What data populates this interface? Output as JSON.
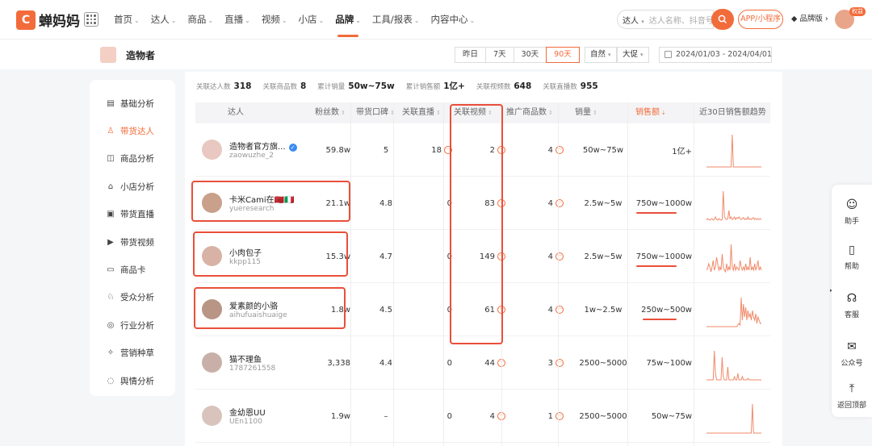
{
  "app": {
    "logo_text": "蝉妈妈"
  },
  "nav": [
    {
      "label": "首页",
      "caret": true
    },
    {
      "label": "达人",
      "caret": true
    },
    {
      "label": "商品",
      "caret": true
    },
    {
      "label": "直播",
      "caret": true
    },
    {
      "label": "视频",
      "caret": true
    },
    {
      "label": "小店",
      "caret": true
    },
    {
      "label": "品牌",
      "caret": true,
      "active": true
    },
    {
      "label": "工具/报表",
      "caret": true
    },
    {
      "label": "内容中心",
      "caret": true
    }
  ],
  "search": {
    "scope": "达人",
    "placeholder": "达人名称、抖音号"
  },
  "header": {
    "app_button": "APP/小程序",
    "brand_version": "品牌版",
    "vip_badge": "权益"
  },
  "brand": {
    "name": "造物者"
  },
  "time_ranges": [
    "昨日",
    "7天",
    "30天",
    "90天"
  ],
  "time_active": "90天",
  "dropdowns": [
    "自然",
    "大促"
  ],
  "date_range": "2024/01/03 - 2024/04/01",
  "sidebar": [
    {
      "label": "基础分析",
      "icon": "chart-icon"
    },
    {
      "label": "带货达人",
      "icon": "person-icon",
      "active": true
    },
    {
      "label": "商品分析",
      "icon": "bag-icon"
    },
    {
      "label": "小店分析",
      "icon": "store-icon"
    },
    {
      "label": "带货直播",
      "icon": "live-icon"
    },
    {
      "label": "带货视频",
      "icon": "play-icon"
    },
    {
      "label": "商品卡",
      "icon": "card-icon"
    },
    {
      "label": "受众分析",
      "icon": "audience-icon"
    },
    {
      "label": "行业分析",
      "icon": "industry-icon"
    },
    {
      "label": "营销种草",
      "icon": "marketing-icon"
    },
    {
      "label": "舆情分析",
      "icon": "sentiment-icon"
    }
  ],
  "stats": [
    {
      "label": "关联达人数",
      "value": "318"
    },
    {
      "label": "关联商品数",
      "value": "8"
    },
    {
      "label": "累计销量",
      "value": "50w~75w"
    },
    {
      "label": "累计销售额",
      "value": "1亿+"
    },
    {
      "label": "关联视频数",
      "value": "648"
    },
    {
      "label": "关联直播数",
      "value": "955"
    }
  ],
  "table": {
    "headers": [
      "达人",
      "粉丝数",
      "带货口碑",
      "关联直播",
      "关联视频",
      "推广商品数",
      "销量",
      "销售额",
      "近30日销售额趋势"
    ],
    "rows": [
      {
        "name": "造物者官方旗...",
        "id": "zaowuzhe_2",
        "verified": true,
        "fans": "59.8w",
        "rating": "5",
        "live": "18",
        "video": "2",
        "products": "4",
        "sales": "50w~75w",
        "revenue": "1亿+",
        "avatar_color": "#e8c8c0",
        "trend": [
          0,
          0,
          0,
          0,
          0,
          0,
          0,
          0,
          0,
          0,
          0,
          0,
          0,
          0,
          0,
          0,
          0,
          0,
          0,
          0,
          0,
          0,
          0,
          1,
          0,
          0,
          0,
          0,
          0,
          0,
          0,
          0,
          0,
          0,
          0,
          0,
          0,
          0,
          0,
          0,
          0,
          0,
          0,
          0,
          0,
          0,
          0,
          0,
          0,
          0
        ]
      },
      {
        "name": "卡米Cami在🇲🇦🇮🇹",
        "id": "yueresearch",
        "verified": false,
        "fans": "21.1w",
        "rating": "4.8",
        "live": "0",
        "video": "83",
        "products": "4",
        "sales": "2.5w~5w",
        "revenue": "750w~1000w",
        "avatar_color": "#c9a08a",
        "trend": [
          0,
          0.05,
          0.02,
          0,
          0.03,
          0.05,
          0,
          0.02,
          0.1,
          0.02,
          0,
          0.05,
          0.02,
          0,
          0.02,
          0.9,
          0.1,
          0.05,
          0.02,
          0.05,
          0.3,
          0.05,
          0.1,
          0.02,
          0.05,
          0.1,
          0.02,
          0.08,
          0.05,
          0.1,
          0.05,
          0.02,
          0.05,
          0.08,
          0.02,
          0.05,
          0.02,
          0.1,
          0.02,
          0.05,
          0.02,
          0.05,
          0.08,
          0.02,
          0.05,
          0.02,
          0.05,
          0.02,
          0.05,
          0.02
        ]
      },
      {
        "name": "小肉包子",
        "id": "kkpp115",
        "verified": false,
        "fans": "15.3w",
        "rating": "4.7",
        "live": "0",
        "video": "149",
        "products": "4",
        "sales": "2.5w~5w",
        "revenue": "750w~1000w",
        "avatar_color": "#d9b2a6",
        "trend": [
          0.1,
          0.15,
          0.3,
          0.2,
          0.05,
          0.2,
          0.4,
          0.1,
          0.2,
          0.5,
          0.3,
          0.1,
          0.2,
          0.1,
          0.6,
          0.2,
          0.1,
          0.05,
          0.3,
          0.1,
          0.2,
          0.1,
          0.9,
          0.2,
          0.1,
          0.3,
          0.1,
          0.2,
          0.15,
          0.1,
          0.4,
          0.2,
          0.1,
          0.2,
          0.1,
          0.3,
          0.1,
          0.2,
          0.1,
          0.5,
          0.1,
          0.2,
          0.1,
          0.3,
          0.1,
          0.2,
          0.4,
          0.1,
          0.2,
          0.1
        ]
      },
      {
        "name": "爱素颜的小骆",
        "id": "aihufuaishuaige",
        "verified": false,
        "fans": "1.8w",
        "rating": "4.5",
        "live": "0",
        "video": "61",
        "products": "4",
        "sales": "1w~2.5w",
        "revenue": "250w~500w",
        "avatar_color": "#b89585",
        "trend": [
          0,
          0,
          0,
          0,
          0,
          0,
          0,
          0,
          0,
          0,
          0,
          0,
          0,
          0,
          0,
          0,
          0,
          0,
          0,
          0,
          0,
          0,
          0,
          0,
          0,
          0,
          0,
          0,
          0.05,
          0.1,
          0.05,
          0.9,
          0.2,
          0.7,
          0.3,
          0.6,
          0.2,
          0.5,
          0.3,
          0.4,
          0.2,
          0.5,
          0.3,
          0.2,
          0.4,
          0.1,
          0.3,
          0.2,
          0.1,
          0.1
        ]
      },
      {
        "name": "猫不理鱼",
        "id": "1787261558",
        "verified": false,
        "fans": "3,338",
        "rating": "4.4",
        "live": "0",
        "video": "44",
        "products": "3",
        "sales": "2500~5000",
        "revenue": "75w~100w",
        "avatar_color": "#c8b0a8",
        "trend": [
          0,
          0,
          0,
          0,
          0,
          0,
          0,
          0.9,
          0.2,
          0,
          0,
          0,
          0,
          0,
          0.7,
          0.1,
          0,
          0,
          0,
          0.4,
          0,
          0,
          0,
          0,
          0,
          0.1,
          0,
          0,
          0.2,
          0,
          0,
          0,
          0.1,
          0,
          0,
          0,
          0,
          0.05,
          0,
          0,
          0,
          0,
          0,
          0,
          0,
          0,
          0,
          0,
          0,
          0
        ]
      },
      {
        "name": "金幼恩UU",
        "id": "UEn1100",
        "verified": false,
        "fans": "1.9w",
        "rating": "–",
        "live": "0",
        "video": "4",
        "products": "1",
        "sales": "2500~5000",
        "revenue": "50w~75w",
        "avatar_color": "#d8c4bc",
        "trend": [
          0,
          0,
          0,
          0,
          0,
          0,
          0,
          0,
          0,
          0,
          0,
          0,
          0,
          0,
          0,
          0,
          0,
          0,
          0,
          0,
          0,
          0,
          0,
          0,
          0,
          0,
          0,
          0,
          0,
          0,
          0,
          0,
          0,
          0,
          0,
          0,
          0,
          0,
          0,
          0,
          0,
          0.9,
          0,
          0,
          0,
          0,
          0,
          0,
          0,
          0
        ]
      }
    ]
  },
  "floatbar": [
    {
      "label": "助手",
      "icon": "robot-icon"
    },
    {
      "label": "帮助",
      "icon": "book-icon"
    },
    {
      "label": "客服",
      "icon": "headset-icon"
    },
    {
      "label": "公众号",
      "icon": "wechat-icon"
    },
    {
      "label": "返回顶部",
      "icon": "back-to-top-icon"
    }
  ],
  "colors": {
    "accent": "#f26b3a",
    "annotation": "#e94f3a",
    "trend_line": "#f08a6a"
  }
}
